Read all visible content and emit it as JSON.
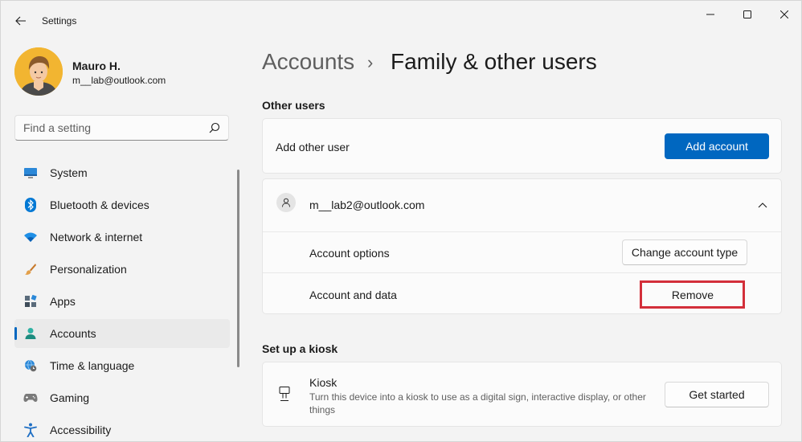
{
  "window": {
    "title": "Settings"
  },
  "profile": {
    "name": "Mauro H.",
    "email": "m__lab@outlook.com"
  },
  "search": {
    "placeholder": "Find a setting"
  },
  "sidebar": {
    "items": [
      {
        "label": "System",
        "icon": "monitor-icon",
        "active": false
      },
      {
        "label": "Bluetooth & devices",
        "icon": "bluetooth-icon",
        "active": false
      },
      {
        "label": "Network & internet",
        "icon": "wifi-icon",
        "active": false
      },
      {
        "label": "Personalization",
        "icon": "brush-icon",
        "active": false
      },
      {
        "label": "Apps",
        "icon": "apps-icon",
        "active": false
      },
      {
        "label": "Accounts",
        "icon": "person-icon",
        "active": true
      },
      {
        "label": "Time & language",
        "icon": "globe-clock-icon",
        "active": false
      },
      {
        "label": "Gaming",
        "icon": "gamepad-icon",
        "active": false
      },
      {
        "label": "Accessibility",
        "icon": "accessibility-icon",
        "active": false
      }
    ]
  },
  "breadcrumb": {
    "parent": "Accounts",
    "separator": "›",
    "current": "Family & other users"
  },
  "other_users": {
    "section_title": "Other users",
    "add_label": "Add other user",
    "add_button": "Add account",
    "user": {
      "email": "m__lab2@outlook.com",
      "expanded": true,
      "options_label": "Account options",
      "change_type_button": "Change account type",
      "data_label": "Account and data",
      "remove_button": "Remove"
    }
  },
  "kiosk": {
    "section_title": "Set up a kiosk",
    "title": "Kiosk",
    "description": "Turn this device into a kiosk to use as a digital sign, interactive display, or other things",
    "button": "Get started"
  },
  "colors": {
    "accent": "#0067c0",
    "highlight": "#d32f3a"
  }
}
